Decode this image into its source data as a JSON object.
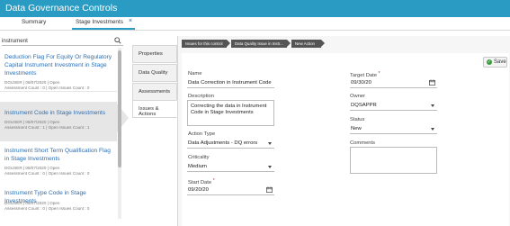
{
  "app": {
    "title": "Data Governance Controls"
  },
  "tabs": [
    {
      "label": "Summary"
    },
    {
      "label": "Stage Investments",
      "close": "×"
    }
  ],
  "search": {
    "value": "instrument"
  },
  "list": [
    {
      "title": "Deduction Flag For Equity Or Regulatory Capital Instrument Investment in Stage Investments",
      "meta1": "DGUSER | 08/07/2020 | Open",
      "meta2": "Assessment Count : 0 | Open Issues Count : 0"
    },
    {
      "title": "Instrument Code in Stage Investments",
      "meta1": "DGUSER | 08/07/2020 | Open",
      "meta2": "Assessment Count : 1 | Open Issues Count : 1"
    },
    {
      "title": "Instrument Short Term Qualification Flag in Stage Investments",
      "meta1": "DGUSER | 08/07/2020 | Open",
      "meta2": "Assessment Count : 0 | Open Issues Count : 0"
    },
    {
      "title": "Instrument Type Code in Stage Investments",
      "meta1": "DGUSER | 08/07/2020 | Open",
      "meta2": "Assessment Count : 0 | Open Issues Count : 0"
    }
  ],
  "side_tabs": [
    "Properties",
    "Data Quality",
    "Assessments",
    "Issues & Actions"
  ],
  "breadcrumb": [
    "Issues for this control",
    "Data Quality Issue in Instr...",
    "New Action"
  ],
  "save": {
    "label": "Save"
  },
  "form": {
    "name_label": "Name",
    "name_value": "Data Correction in Instrument Code",
    "description_label": "Description",
    "description_value": "Correcting the data in Instrument Code in Stage Investments",
    "action_type_label": "Action Type",
    "action_type_value": "Data Adjustments - DQ errors",
    "criticality_label": "Criticality",
    "criticality_value": "Medium",
    "start_date_label": "Start Date",
    "start_date_value": "09/20/20",
    "target_date_label": "Target Date",
    "target_date_value": "09/30/20",
    "owner_label": "Owner",
    "owner_value": "DQSAPPR",
    "status_label": "Status",
    "status_value": "New",
    "comments_label": "Comments",
    "required_mark": "*"
  },
  "colors": {
    "accent": "#2a9bc2",
    "link": "#2a6fb5",
    "crumb": "#555555",
    "save_icon": "#3a9a3a"
  }
}
